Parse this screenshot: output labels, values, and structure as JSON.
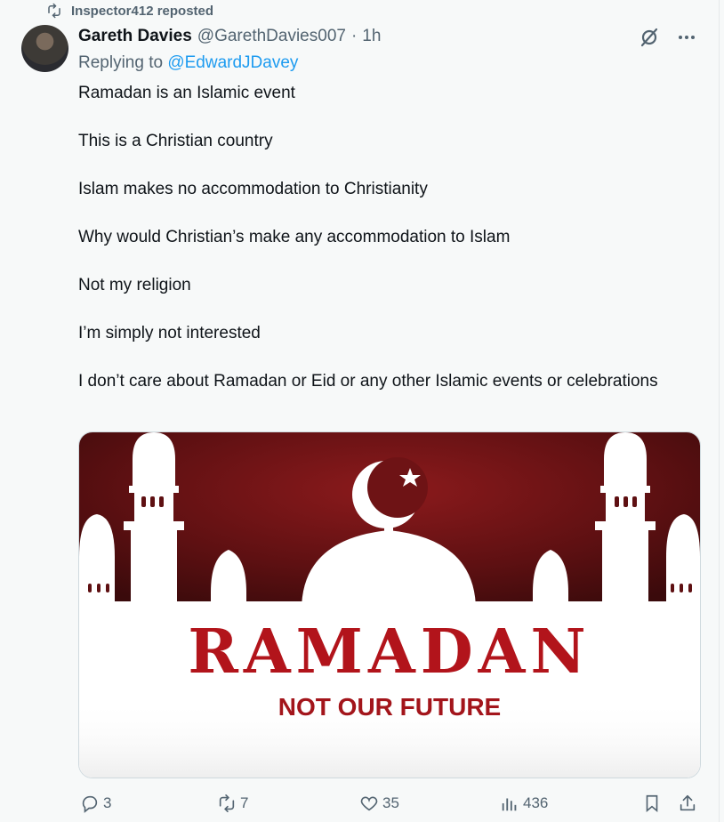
{
  "repost": {
    "label": "Inspector412 reposted",
    "icon": "repost-icon"
  },
  "tweet": {
    "display_name": "Gareth Davies",
    "handle": "@GarethDavies007",
    "separator": "·",
    "time": "1h",
    "replying_prefix": "Replying to ",
    "replying_to": "@EdwardJDavey",
    "paragraphs": [
      "Ramadan is an Islamic event",
      "This is a Christian country",
      "Islam makes no accommodation to Christianity",
      "Why would Christian’s make any accommodation to Islam",
      "Not my religion",
      "I’m simply not interested",
      "I don’t care about Ramadan or Eid or any other Islamic events or celebrations"
    ]
  },
  "media": {
    "headline": "RAMADAN",
    "subline": "NOT OUR FUTURE",
    "colors": {
      "dark_red": "#5c0f12",
      "red": "#a8161c",
      "white": "#ffffff"
    }
  },
  "actions": {
    "replies": "3",
    "reposts": "7",
    "likes": "35",
    "views": "436"
  },
  "colors": {
    "accent": "#1d9bf0",
    "muted": "#536471",
    "text": "#0f1419",
    "background": "#f7f9f9"
  }
}
